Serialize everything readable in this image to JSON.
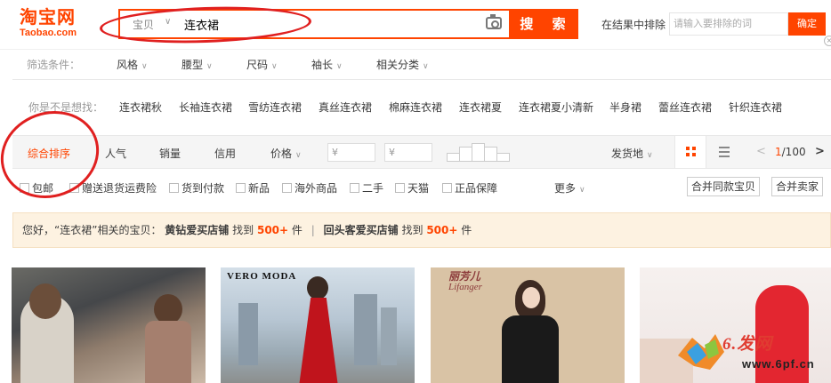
{
  "header": {
    "logo_cn": "淘宝网",
    "logo_en": "Taobao.com",
    "search_category": "宝贝",
    "search_query": "连衣裙",
    "search_button": "搜 索",
    "exclude_label": "在结果中排除",
    "exclude_placeholder": "请输入要排除的词",
    "exclude_button": "确定"
  },
  "filters": {
    "label": "筛选条件：",
    "items": [
      "风格",
      "腰型",
      "尺码",
      "袖长",
      "相关分类"
    ]
  },
  "guess": {
    "label": "你是不是想找：",
    "items": [
      "连衣裙秋",
      "长袖连衣裙",
      "雪纺连衣裙",
      "真丝连衣裙",
      "棉麻连衣裙",
      "连衣裙夏",
      "连衣裙夏小清新",
      "半身裙",
      "蕾丝连衣裙",
      "针织连衣裙"
    ]
  },
  "sort": {
    "items": [
      "综合排序",
      "人气",
      "销量",
      "信用",
      "价格"
    ],
    "price_min_placeholder": "¥",
    "price_max_placeholder": "¥",
    "price_dash": "-",
    "ship_from": "发货地",
    "page_current": "1",
    "page_total": "/100"
  },
  "checks": {
    "items": [
      "包邮",
      "赠送退货运费险",
      "货到付款",
      "新品",
      "海外商品",
      "二手",
      "天猫",
      "正品保障"
    ],
    "more": "更多",
    "merge_same": "合并同款宝贝",
    "merge_seller": "合并卖家"
  },
  "tip": {
    "hello": "您好，",
    "query": "“连衣裙”",
    "related": "相关的宝贝：",
    "shop1": "黄钻爱买店铺",
    "found1": "找到",
    "count1": "500+",
    "unit1": "件",
    "sep": "|",
    "shop2": "回头客爱买店铺",
    "found2": "找到",
    "count2": "500+",
    "unit2": "件"
  },
  "products": {
    "brand_vm": "VERO MODA",
    "brand_lf_cn": "丽芳儿",
    "brand_lf_en": "Lifanger"
  },
  "watermark": {
    "text": "6.发网",
    "url": "www.6pf.cn"
  },
  "colors": {
    "accent": "#ff4400",
    "annotation": "#e02020",
    "tip_bg": "#fdf2e1"
  },
  "icons": [
    "camera-icon",
    "grid-view-icon",
    "list-view-icon",
    "chevron-left-icon",
    "chevron-right-icon",
    "chevron-down-icon",
    "close-icon"
  ]
}
